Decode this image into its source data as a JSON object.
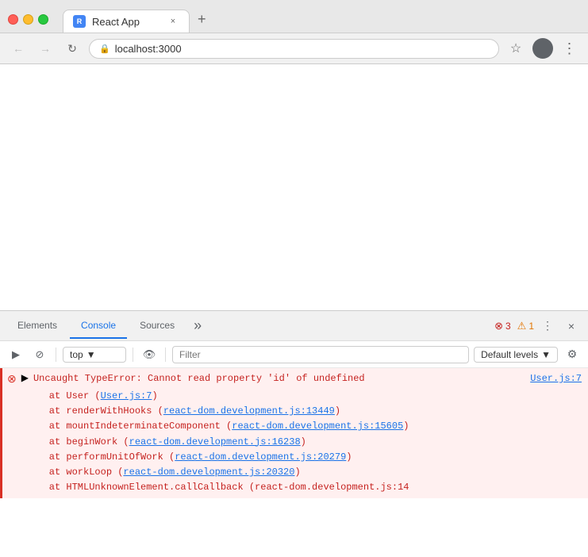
{
  "browser": {
    "tab": {
      "favicon_text": "R",
      "title": "React App",
      "close_label": "×"
    },
    "new_tab_label": "+",
    "toolbar": {
      "back_icon": "←",
      "forward_icon": "→",
      "reload_icon": "↻",
      "url": "localhost:3000",
      "url_protocol": "🔒",
      "star_icon": "☆",
      "profile_text": "",
      "menu_icon": "⋮"
    }
  },
  "devtools": {
    "tabs": [
      {
        "label": "Elements",
        "active": false
      },
      {
        "label": "Console",
        "active": true
      },
      {
        "label": "Sources",
        "active": false
      }
    ],
    "more_icon": "»",
    "error_count": "3",
    "warning_count": "1",
    "more_btn": "⋮",
    "close_btn": "×",
    "console_toolbar": {
      "play_icon": "▶",
      "ban_icon": "🚫",
      "context_value": "top",
      "context_arrow": "▼",
      "eye_icon": "👁",
      "filter_placeholder": "Filter",
      "default_levels": "Default levels",
      "levels_arrow": "▼",
      "settings_icon": "⚙"
    },
    "console": {
      "error_icon": "⊗",
      "expand_icon": "▶",
      "main_error": "Uncaught TypeError: Cannot read property 'id' of undefined",
      "error_file": "User.js:7",
      "undefined_text": "undefined",
      "stack": [
        {
          "prefix": "at User (",
          "link": "User.js:7",
          "suffix": ")"
        },
        {
          "prefix": "at renderWithHooks (",
          "link": "react-dom.development.js:13449",
          "suffix": ")"
        },
        {
          "prefix": "at mountIndeterminateComponent (",
          "link": "react-dom.development.js:15605",
          "suffix": ")"
        },
        {
          "prefix": "at beginWork (",
          "link": "react-dom.development.js:16238",
          "suffix": ")"
        },
        {
          "prefix": "at performUnitOfWork (",
          "link": "react-dom.development.js:20279",
          "suffix": ")"
        },
        {
          "prefix": "at workLoop (",
          "link": "react-dom.development.js:20320",
          "suffix": ")"
        },
        {
          "prefix": "at HTMLUnknownElement.callCallback (react-dom.development.js:14",
          "link": "",
          "suffix": ""
        }
      ]
    }
  }
}
